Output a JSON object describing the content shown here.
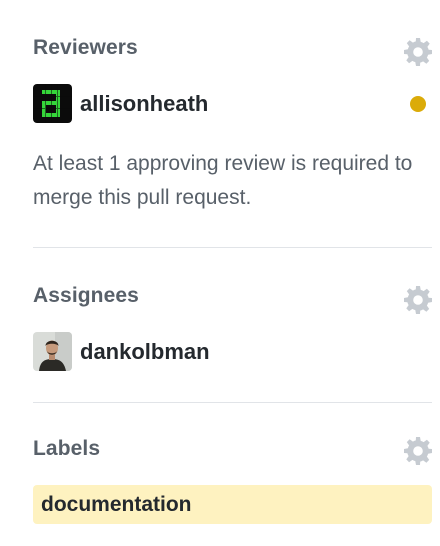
{
  "reviewers": {
    "title": "Reviewers",
    "settings_icon": "gear-icon",
    "user": {
      "name": "allisonheath",
      "avatar": "identicon-a-avatar",
      "status": "pending",
      "status_color": "#dbab09"
    },
    "note": "At least 1 approving review is required to merge this pull request."
  },
  "assignees": {
    "title": "Assignees",
    "settings_icon": "gear-icon",
    "user": {
      "name": "dankolbman",
      "avatar": "photo-avatar"
    }
  },
  "labels": {
    "title": "Labels",
    "settings_icon": "gear-icon",
    "items": [
      {
        "name": "documentation",
        "color": "#fef2c0"
      }
    ]
  },
  "colors": {
    "heading": "#586069",
    "text": "#24292e",
    "gear": "#c6cbd1",
    "divider": "#e1e4e8"
  }
}
